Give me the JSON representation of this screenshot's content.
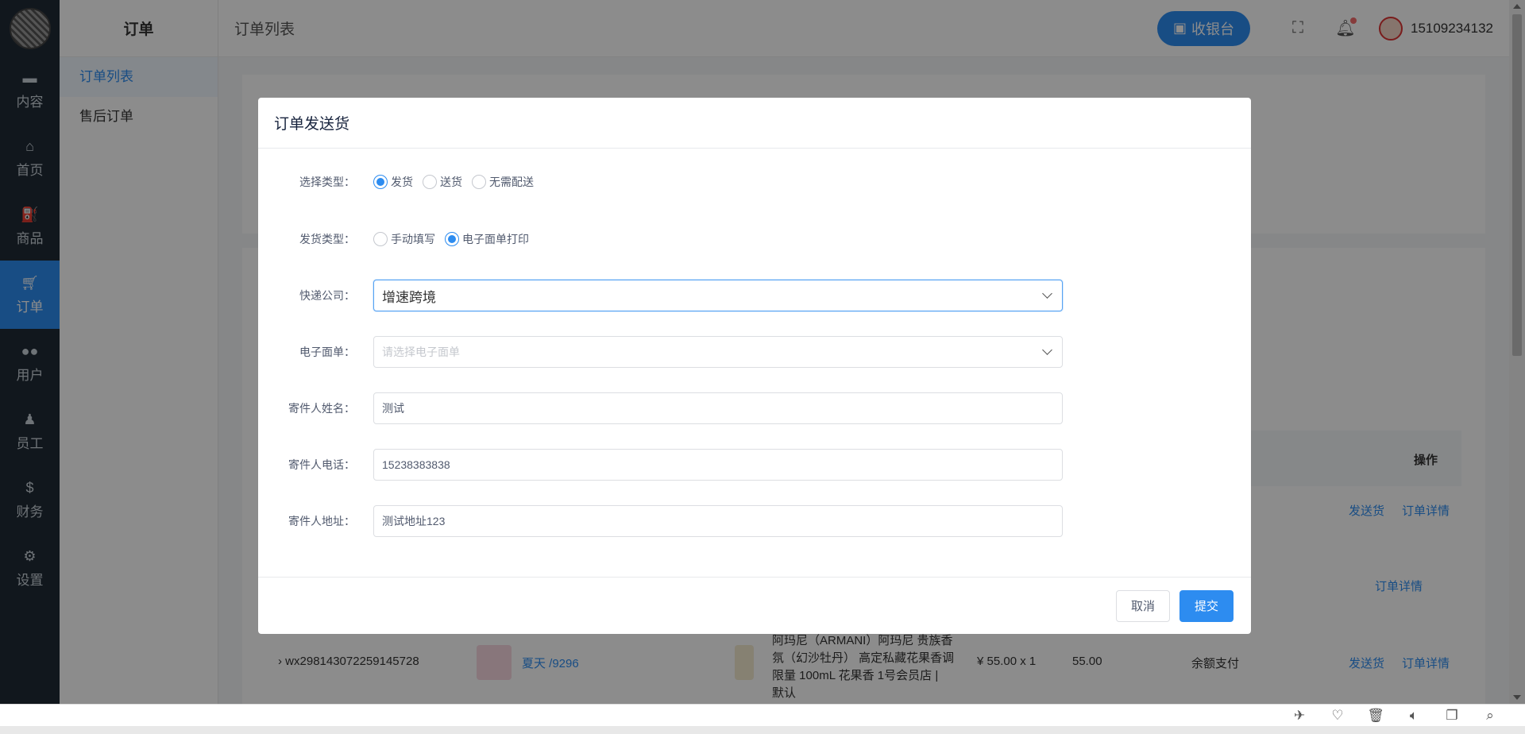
{
  "nav": {
    "items": [
      {
        "label": "内容",
        "icon": "folder-icon"
      },
      {
        "label": "首页",
        "icon": "home-icon"
      },
      {
        "label": "商品",
        "icon": "basket-icon"
      },
      {
        "label": "订单",
        "icon": "cart-icon"
      },
      {
        "label": "用户",
        "icon": "users-icon"
      },
      {
        "label": "员工",
        "icon": "person-icon"
      },
      {
        "label": "财务",
        "icon": "dollar-icon"
      },
      {
        "label": "设置",
        "icon": "gear-icon"
      }
    ],
    "active": "订单"
  },
  "submenu": {
    "title": "订单",
    "items": [
      "订单列表",
      "售后订单"
    ]
  },
  "header": {
    "breadcrumb": "订单列表",
    "cashier_label": "收银台",
    "username": "15109234132"
  },
  "background": {
    "column_action": "操作",
    "row1_actions": [
      "发送货",
      "订单详情"
    ],
    "row2_action": "订单详情",
    "row3": {
      "order_no": "wx298143072259145728",
      "user": "夏天 /9296",
      "product_lines": [
        "阿玛尼（ARMANI）阿玛尼 贵族香",
        "氛（幻沙牡丹） 高定私藏花果香调",
        "限量 100mL 花果香 1号会员店 |",
        "默认"
      ],
      "price": "¥ 55.00 x 1",
      "amount": "55.00",
      "pay": "余额支付",
      "actions": [
        "发送货",
        "订单详情"
      ]
    }
  },
  "modal": {
    "title": "订单发送货",
    "select_type": {
      "label": "选择类型：",
      "options": [
        "发货",
        "送货",
        "无需配送"
      ],
      "selected": "发货"
    },
    "ship_type": {
      "label": "发货类型：",
      "options": [
        "手动填写",
        "电子面单打印"
      ],
      "selected": "电子面单打印"
    },
    "courier": {
      "label": "快递公司：",
      "value": "增速跨境"
    },
    "ewaybill": {
      "label": "电子面单：",
      "placeholder": "请选择电子面单"
    },
    "sender_name": {
      "label": "寄件人姓名：",
      "value": "测试"
    },
    "sender_phone": {
      "label": "寄件人电话：",
      "value": "15238383838"
    },
    "sender_address": {
      "label": "寄件人地址：",
      "value": "测试地址123"
    },
    "cancel_label": "取消",
    "submit_label": "提交"
  },
  "colors": {
    "primary": "#2d8cf0",
    "nav_bg": "#1f2a35"
  }
}
